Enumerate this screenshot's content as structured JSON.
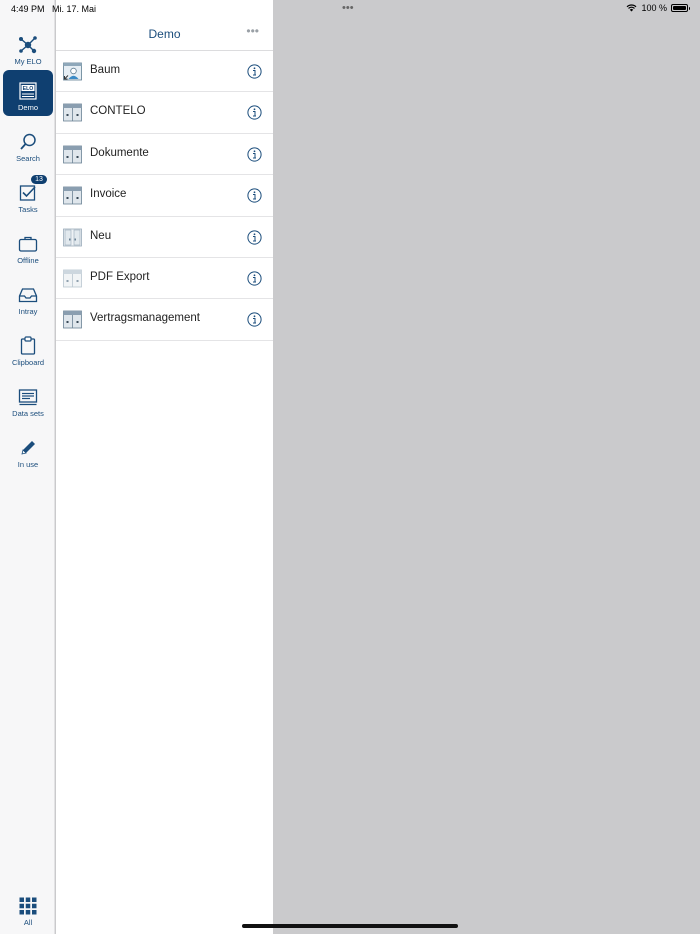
{
  "status_bar": {
    "time": "4:49 PM",
    "date": "Mi. 17. Mai",
    "battery": "100 %"
  },
  "rail": {
    "items": [
      {
        "label": "My ELO",
        "icon": "network-icon"
      },
      {
        "label": "Demo",
        "icon": "elo-archive-icon",
        "active": true
      },
      {
        "label": "Search",
        "icon": "search-icon"
      },
      {
        "label": "Tasks",
        "icon": "tasks-icon",
        "badge": "13"
      },
      {
        "label": "Offline",
        "icon": "briefcase-icon"
      },
      {
        "label": "Intray",
        "icon": "inbox-icon"
      },
      {
        "label": "Clipboard",
        "icon": "clipboard-icon"
      },
      {
        "label": "Data sets",
        "icon": "datasets-icon"
      },
      {
        "label": "In use",
        "icon": "pencil-icon"
      },
      {
        "label": "All",
        "icon": "grid-icon"
      }
    ],
    "accent_color": "#0f3f70"
  },
  "panel": {
    "title": "Demo",
    "items": [
      {
        "label": "Baum",
        "icon": "folder-user-icon"
      },
      {
        "label": "CONTELO",
        "icon": "cabinet-icon"
      },
      {
        "label": "Dokumente",
        "icon": "cabinet-icon"
      },
      {
        "label": "Invoice",
        "icon": "cabinet-icon"
      },
      {
        "label": "Neu",
        "icon": "cabinet-open-icon"
      },
      {
        "label": "PDF Export",
        "icon": "cabinet-light-icon"
      },
      {
        "label": "Vertragsmanagement",
        "icon": "cabinet-icon"
      }
    ]
  }
}
